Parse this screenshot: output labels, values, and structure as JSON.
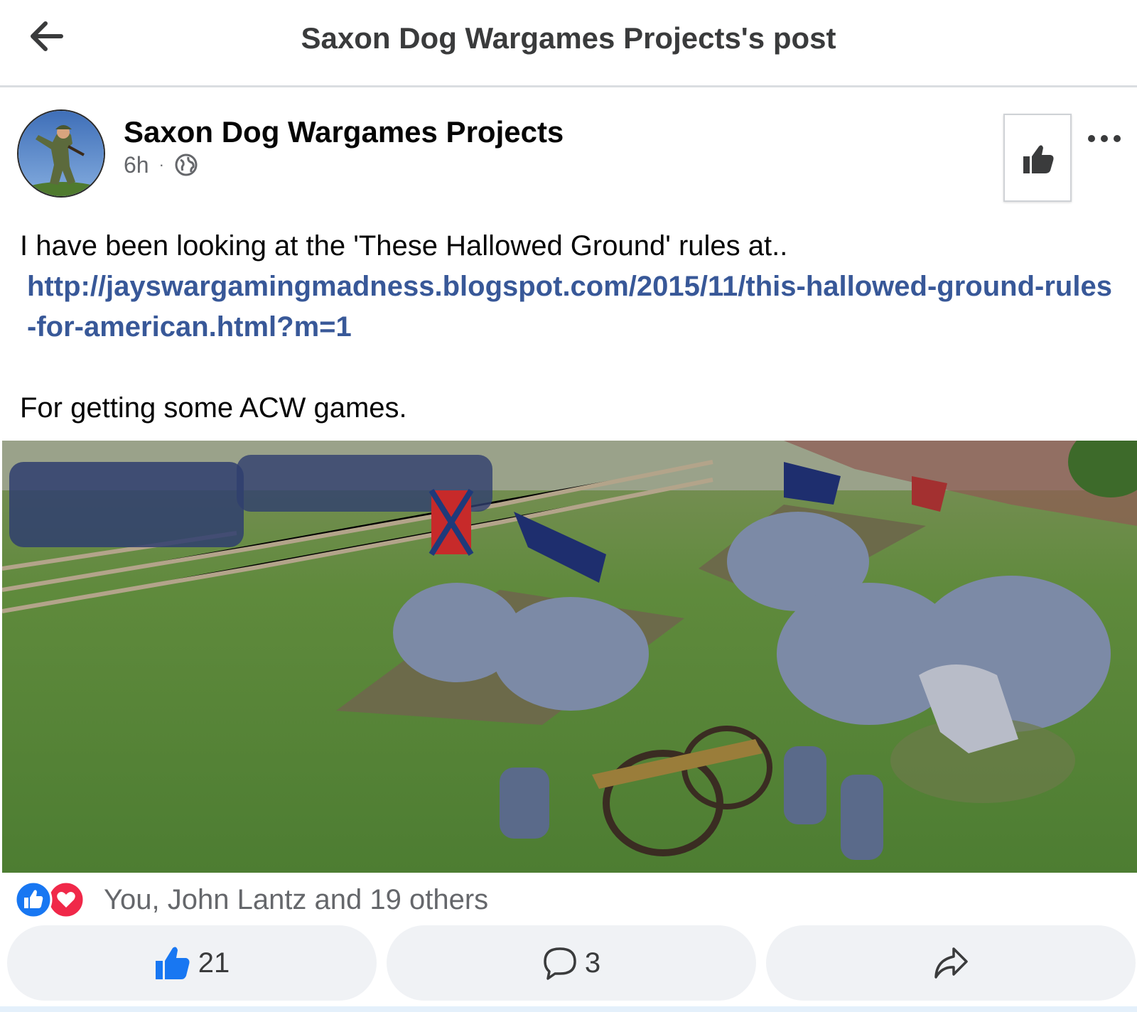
{
  "header": {
    "title": "Saxon Dog Wargames Projects's post",
    "back_icon": "arrow-left-icon"
  },
  "post": {
    "author": "Saxon Dog Wargames Projects",
    "time": "6h",
    "separator": "·",
    "privacy_icon": "globe-icon",
    "like_page_icon": "thumbs-up-icon",
    "more_icon": "ellipsis-icon",
    "text_line1": "I have been looking at the 'These Hallowed Ground' rules at..",
    "link": "http://jayswargamingmadness.blogspot.com/2015/11/this-hallowed-ground-rules-for-american.html?m=1",
    "text_line2": "For getting some ACW games."
  },
  "reactions": {
    "summary": "You, John Lantz and 19 others",
    "icons": [
      "like-reaction-icon",
      "love-reaction-icon"
    ],
    "colors": {
      "like": "#1877f2",
      "love": "#f02849"
    }
  },
  "actions": {
    "like_count": "21",
    "comment_count": "3",
    "share_icon": "share-arrow-icon"
  },
  "colors": {
    "link": "#385898",
    "accent": "#1877f2"
  }
}
